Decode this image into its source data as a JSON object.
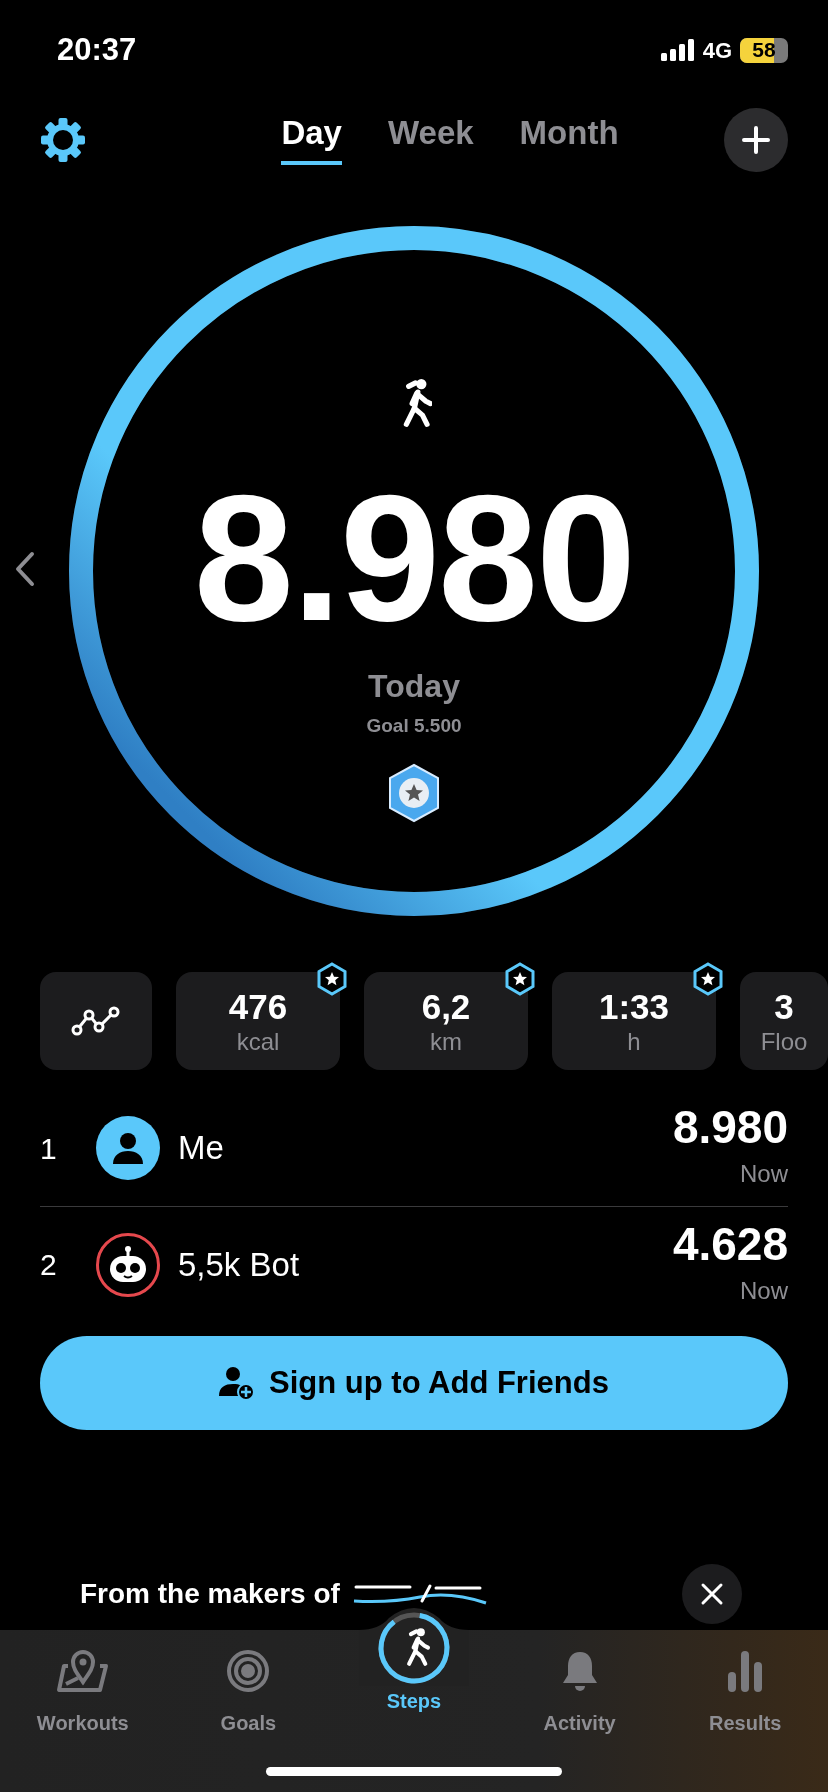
{
  "status_bar": {
    "time": "20:37",
    "network": "4G",
    "battery": "58"
  },
  "tabs": [
    {
      "label": "Day",
      "selected": true
    },
    {
      "label": "Week",
      "selected": false
    },
    {
      "label": "Month",
      "selected": false
    }
  ],
  "ring": {
    "level": 1,
    "steps": "8.980",
    "period": "Today",
    "goal": "Goal 5.500"
  },
  "stats": [
    {
      "kind": "chart"
    },
    {
      "kind": "stat",
      "value": "476",
      "unit": "kcal",
      "achieved": true
    },
    {
      "kind": "stat",
      "value": "6,2",
      "unit": "km",
      "achieved": true
    },
    {
      "kind": "stat",
      "value": "1:33",
      "unit": "h",
      "achieved": true
    },
    {
      "kind": "stat",
      "value": "3",
      "unit": "Floo"
    }
  ],
  "leaderboard": [
    {
      "rank": "1",
      "kind": "user",
      "name": "Me",
      "steps": "8.980",
      "time": "Now"
    },
    {
      "rank": "2",
      "kind": "bot",
      "name": "5,5k Bot",
      "steps": "4.628",
      "time": "Now"
    }
  ],
  "signup_button": "Sign up to Add Friends",
  "banner": {
    "text": "From the makers of"
  },
  "nav": [
    {
      "kind": "workouts",
      "label": "Workouts",
      "selected": false
    },
    {
      "kind": "goals",
      "label": "Goals",
      "selected": false
    },
    {
      "kind": "steps",
      "label": "Steps",
      "selected": true
    },
    {
      "kind": "activity",
      "label": "Activity",
      "selected": false
    },
    {
      "kind": "results",
      "label": "Results",
      "selected": false
    }
  ]
}
